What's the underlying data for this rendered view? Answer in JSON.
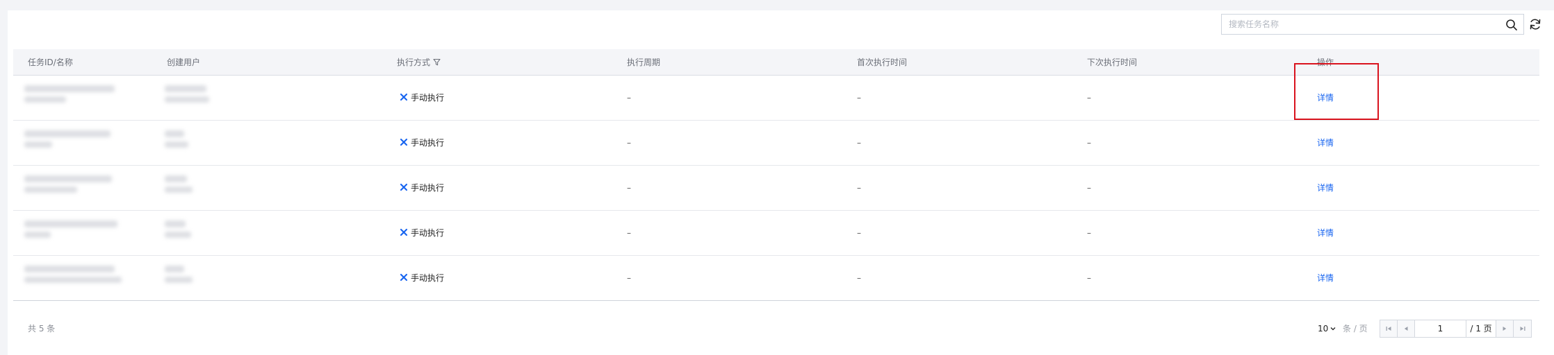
{
  "search": {
    "placeholder": "搜索任务名称",
    "value": ""
  },
  "columns": [
    "任务ID/名称",
    "创建用户",
    "执行方式",
    "执行周期",
    "首次执行时间",
    "下次执行时间",
    "操作"
  ],
  "rows": [
    {
      "mode": "手动执行",
      "period": "–",
      "first_run": "–",
      "next_run": "–",
      "action": "详情"
    },
    {
      "mode": "手动执行",
      "period": "–",
      "first_run": "–",
      "next_run": "–",
      "action": "详情"
    },
    {
      "mode": "手动执行",
      "period": "–",
      "first_run": "–",
      "next_run": "–",
      "action": "详情"
    },
    {
      "mode": "手动执行",
      "period": "–",
      "first_run": "–",
      "next_run": "–",
      "action": "详情"
    },
    {
      "mode": "手动执行",
      "period": "–",
      "first_run": "–",
      "next_run": "–",
      "action": "详情"
    }
  ],
  "footer": {
    "total": "共 5 条",
    "page_size": "10",
    "per_page": "条 / 页",
    "current_page": "1",
    "total_pages": "/ 1 页"
  },
  "icons": {
    "search": "search-icon",
    "refresh": "refresh-icon",
    "filter": "filter-icon",
    "mode": "manual-run-icon"
  },
  "colors": {
    "link": "#1a66f0",
    "highlight": "#d9121d"
  }
}
